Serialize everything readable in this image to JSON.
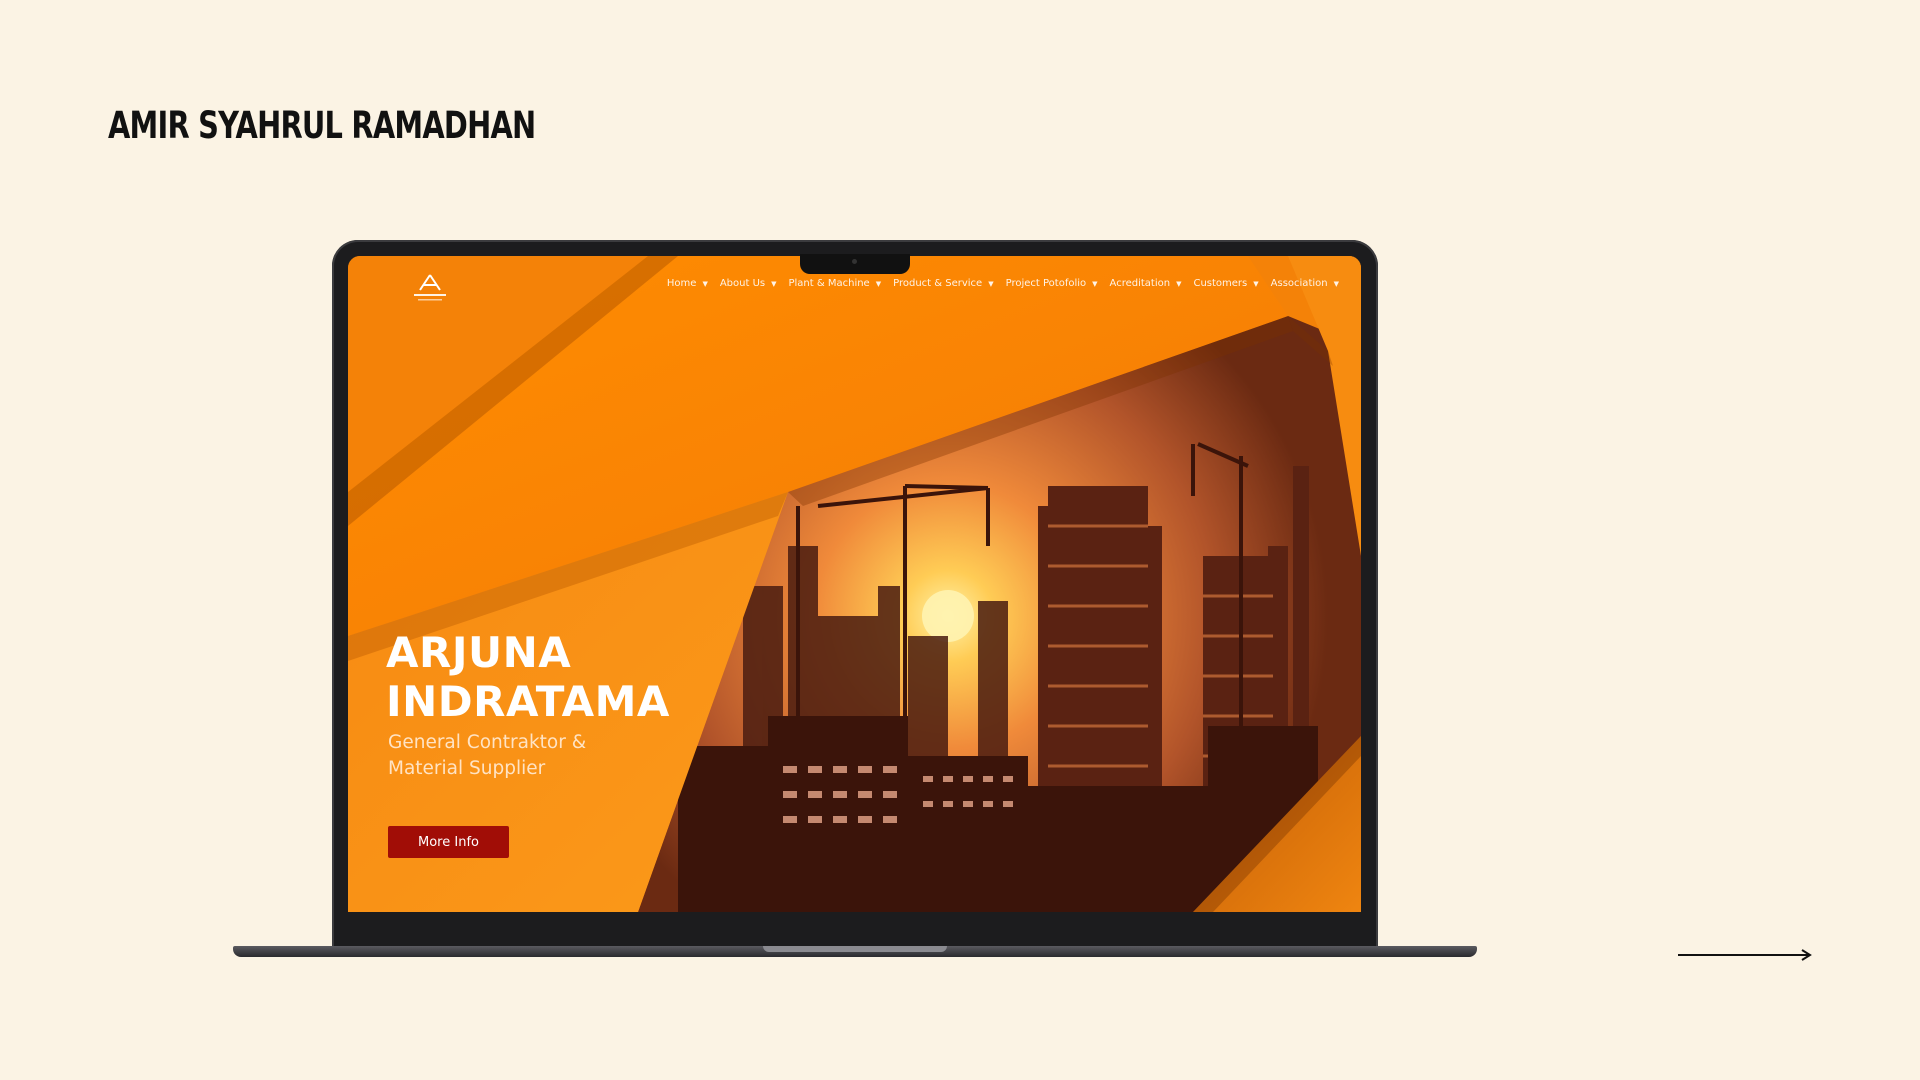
{
  "author": {
    "name": "AMIR SYAHRUL RAMADHAN"
  },
  "site": {
    "nav": [
      {
        "label": "Home"
      },
      {
        "label": "About Us"
      },
      {
        "label": "Plant & Machine"
      },
      {
        "label": "Product & Service"
      },
      {
        "label": "Project Potofolio"
      },
      {
        "label": "Acreditation"
      },
      {
        "label": "Customers"
      },
      {
        "label": "Association"
      }
    ],
    "hero": {
      "title_line1": "ARJUNA",
      "title_line2": "INDRATAMA",
      "subtitle_line1": "General Contraktor &",
      "subtitle_line2": "Material Supplier",
      "button_label": "More Info"
    }
  },
  "colors": {
    "page_background": "#fbf3e4",
    "hero_orange": "#f5850a",
    "button_red": "#a10d06"
  },
  "icons": {
    "logo": "arjuna-logo-icon",
    "nav_caret": "caret-down-icon",
    "next": "arrow-right-icon"
  }
}
